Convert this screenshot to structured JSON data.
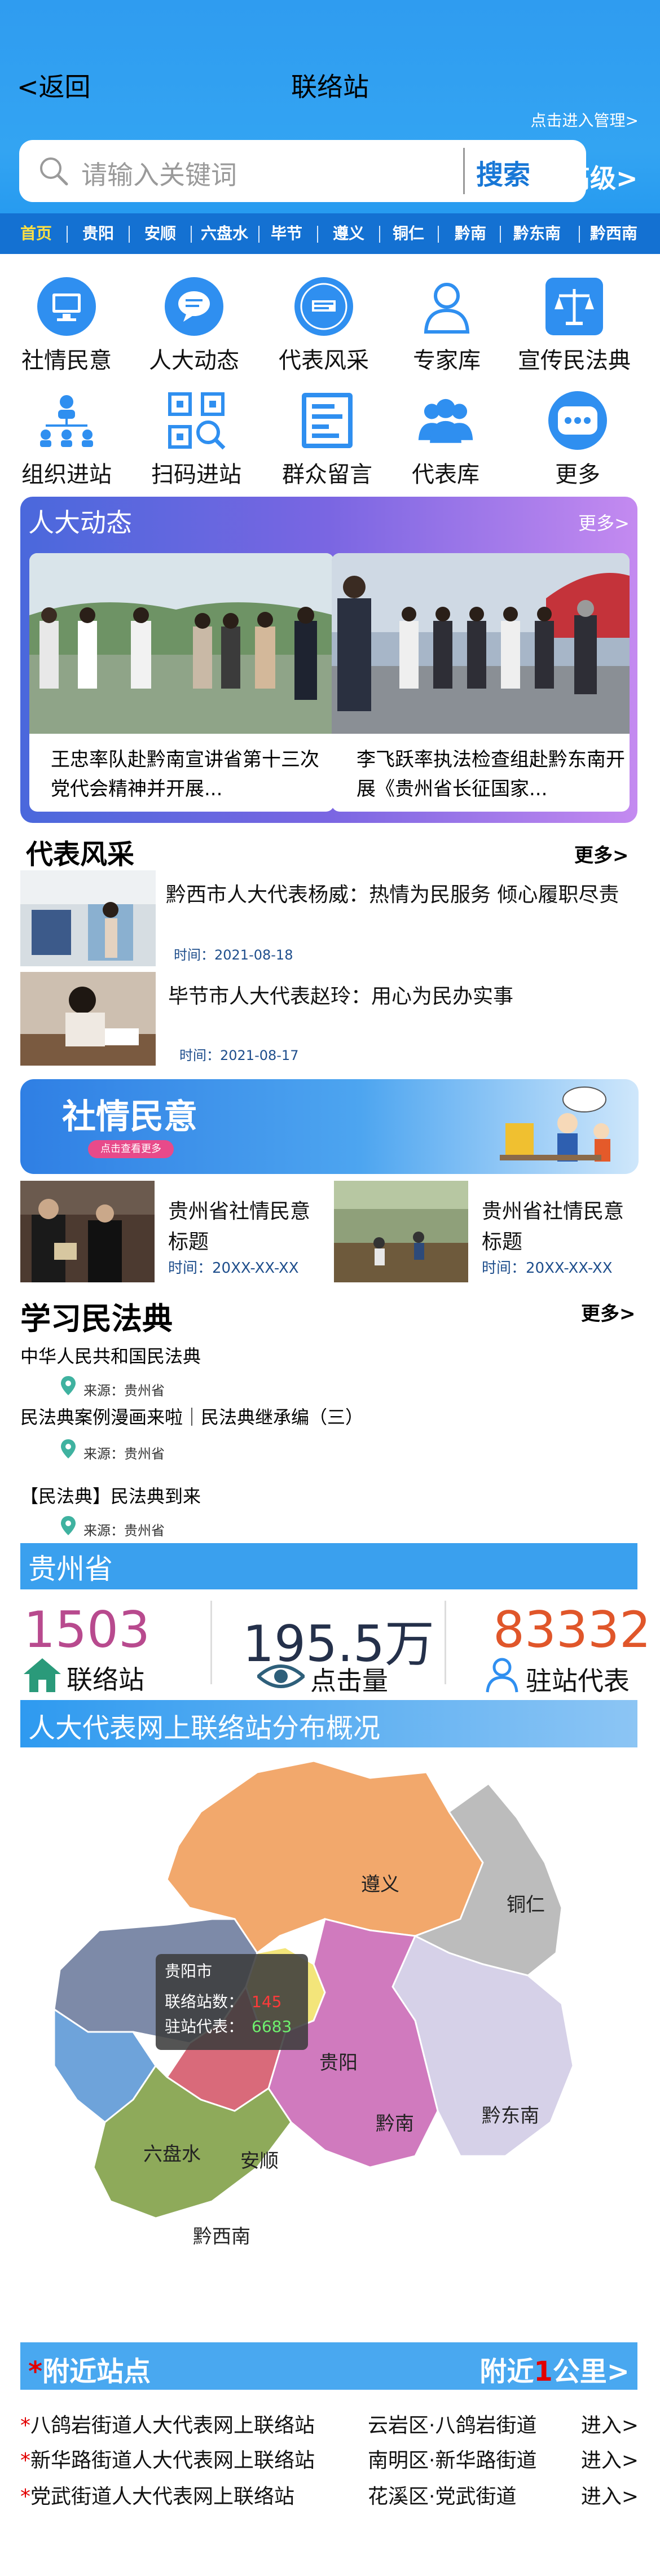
{
  "header": {
    "back_label": "<返回",
    "title": "联络站",
    "manage_label": "点击进入管理>",
    "search_placeholder": "请输入关键词",
    "search_button": "搜索",
    "advanced_label": "高级>"
  },
  "tabs": [
    "首页",
    "贵阳",
    "安顺",
    "六盘水",
    "毕节",
    "遵义",
    "铜仁",
    "黔南",
    "黔东南",
    "黔西南"
  ],
  "grid": [
    {
      "label": "社情民意",
      "icon": "computer-icon"
    },
    {
      "label": "人大动态",
      "icon": "chat-bubble-icon"
    },
    {
      "label": "代表风采",
      "icon": "fengcai-logo-icon"
    },
    {
      "label": "专家库",
      "icon": "user-icon"
    },
    {
      "label": "宣传民法典",
      "icon": "scales-icon"
    },
    {
      "label": "组织进站",
      "icon": "org-chart-icon"
    },
    {
      "label": "扫码进站",
      "icon": "qr-scan-icon"
    },
    {
      "label": "群众留言",
      "icon": "message-board-icon"
    },
    {
      "label": "代表库",
      "icon": "group-icon"
    },
    {
      "label": "更多",
      "icon": "more-dots-icon"
    }
  ],
  "renda": {
    "title": "人大动态",
    "more": "更多>",
    "cards": [
      {
        "caption": "王忠率队赴黔南宣讲省第十三次党代会精神并开展..."
      },
      {
        "caption": "李飞跃率执法检查组赴黔东南开展《贵州省长征国家..."
      }
    ]
  },
  "fengcai": {
    "title": "代表风采",
    "more": "更多>",
    "items": [
      {
        "text": "黔西市人大代表杨威：热情为民服务 倾心履职尽责",
        "time": "时间：2021-08-18"
      },
      {
        "text": "毕节市人大代表赵玲：用心为民办实事",
        "time": "时间：2021-08-17"
      }
    ]
  },
  "banner": {
    "title": "社情民意",
    "pill": "点击查看更多"
  },
  "sheqing": [
    {
      "title": "贵州省社情民意标题",
      "time": "时间：20XX-XX-XX"
    },
    {
      "title": "贵州省社情民意标题",
      "time": "时间：20XX-XX-XX"
    }
  ],
  "law": {
    "title": "学习民法典",
    "more": "更多>",
    "items": [
      {
        "title": "中华人民共和国民法典",
        "source": "来源：贵州省"
      },
      {
        "title": "民法典案例漫画来啦｜民法典继承编（三）",
        "source": "来源：贵州省"
      },
      {
        "title": "【民法典】民法典到来",
        "source": "来源：贵州省"
      }
    ]
  },
  "province": {
    "name": "贵州省",
    "stats": [
      {
        "value": "1503",
        "label": "联络站",
        "color": "#b84a8e"
      },
      {
        "value": "195.5万",
        "label": "点击量",
        "color": "#24304a"
      },
      {
        "value": "83332",
        "label": "驻站代表",
        "color": "#e0562a"
      }
    ]
  },
  "map": {
    "title": "人大代表网上联络站分布概况",
    "regions": [
      "遵义",
      "铜仁",
      "贵阳",
      "黔东南",
      "黔南",
      "六盘水",
      "安顺",
      "黔西南"
    ],
    "tooltip": {
      "city": "贵阳市",
      "stations_label": "联络站数：",
      "stations": "145",
      "reps_label": "驻站代表：",
      "reps": "6683"
    }
  },
  "nearby": {
    "title_star": "*",
    "title": "附近站点",
    "range_pre": "附近",
    "range_num": "1",
    "range_post": "公里>",
    "stations": [
      {
        "name": "八鸽岩街道人大代表网上联络站",
        "area": "云岩区·八鸽岩街道",
        "go": "进入>"
      },
      {
        "name": "新华路街道人大代表网上联络站",
        "area": "南明区·新华路街道",
        "go": "进入>"
      },
      {
        "name": "党武街道人大代表网上联络站",
        "area": "花溪区·党武街道",
        "go": "进入>"
      }
    ]
  }
}
